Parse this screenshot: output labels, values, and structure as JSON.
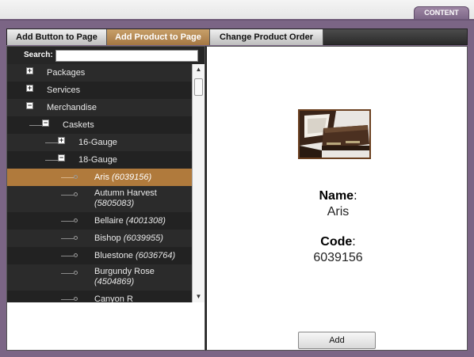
{
  "header": {
    "content_tab": "CONTENT"
  },
  "tabs": [
    {
      "label": "Add Button to Page"
    },
    {
      "label": "Add Product to Page"
    },
    {
      "label": "Change Product Order"
    }
  ],
  "search": {
    "label": "Search:",
    "value": ""
  },
  "tree": {
    "packages": "Packages",
    "services": "Services",
    "merchandise": "Merchandise",
    "caskets": "Caskets",
    "gauge16": "16-Gauge",
    "gauge18": "18-Gauge",
    "items": [
      {
        "name": "Aris",
        "code": "(6039156)"
      },
      {
        "name": "Autumn Harvest",
        "code": "(5805083)"
      },
      {
        "name": "Bellaire",
        "code": "(4001308)"
      },
      {
        "name": "Bishop",
        "code": "(6039955)"
      },
      {
        "name": "Bluestone",
        "code": "(6036764)"
      },
      {
        "name": "Burgundy Rose",
        "code": "(4504869)"
      },
      {
        "name": "Canyon R",
        "code": ""
      }
    ]
  },
  "detail": {
    "name_label": "Name",
    "name_value": "Aris",
    "code_label": "Code",
    "code_value": "6039156",
    "add_button": "Add"
  }
}
